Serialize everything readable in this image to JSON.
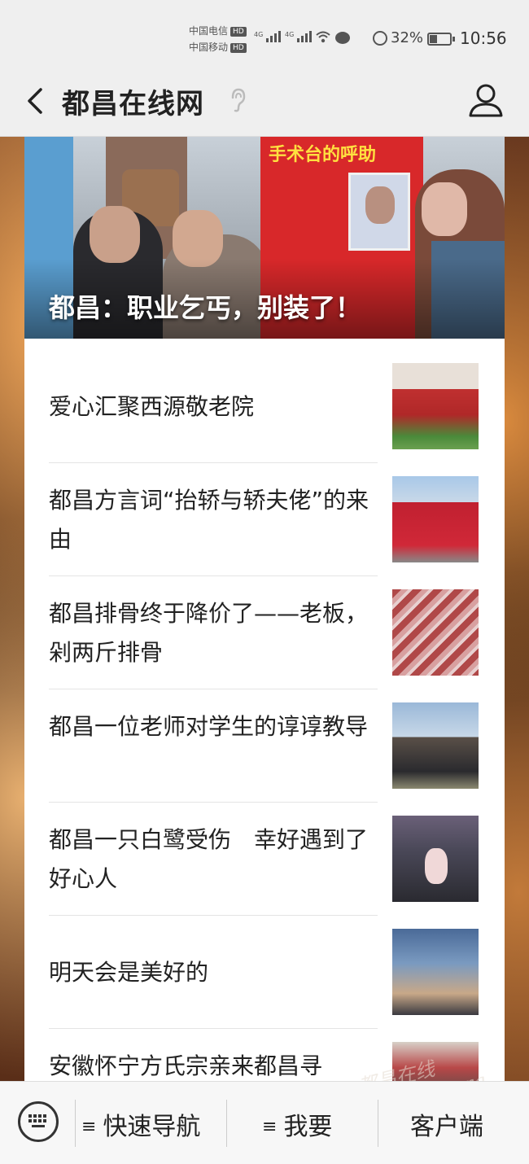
{
  "status_bar": {
    "carrier1": "中国电信",
    "carrier2": "中国移动",
    "hd": "HD",
    "network": "4G",
    "battery_percent": "32%",
    "time": "10:56"
  },
  "nav": {
    "title": "都昌在线网"
  },
  "hero": {
    "caption": "都昌：职业乞丐，别装了！",
    "banner_heading": "手术台的呼助"
  },
  "news": [
    {
      "title": "爱心汇聚西源敬老院"
    },
    {
      "title": "都昌方言词“抬轿与轿夫佬”的来由"
    },
    {
      "title": "都昌排骨终于降价了——老板，剁两斤排骨"
    },
    {
      "title": "都昌一位老师对学生的谆谆教导"
    },
    {
      "title": "都昌一只白鹭受伤　幸好遇到了好心人"
    },
    {
      "title": "明天会是美好的"
    },
    {
      "title": "安徽怀宁方氏宗亲来都昌寻"
    }
  ],
  "toolbar": {
    "quick_nav": "快速导航",
    "want": "我要",
    "client": "客户端",
    "menu_glyph": "≡"
  },
  "watermark": "都昌在线 duchang.org"
}
